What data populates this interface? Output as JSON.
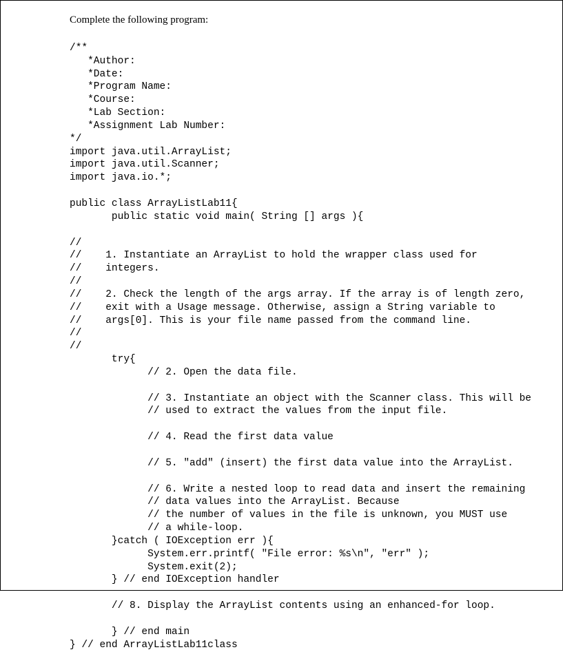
{
  "header": {
    "instruction": "Complete the following program:"
  },
  "code": {
    "line01": "/**",
    "line02": "   *Author:",
    "line03": "   *Date:",
    "line04": "   *Program Name:",
    "line05": "   *Course:",
    "line06": "   *Lab Section:",
    "line07": "   *Assignment Lab Number:",
    "line08": "*/",
    "line09": "import java.util.ArrayList;",
    "line10": "import java.util.Scanner;",
    "line11": "import java.io.*;",
    "line12": "",
    "line13": "public class ArrayListLab11{",
    "line14": "       public static void main( String [] args ){",
    "line15": "",
    "line16": "//",
    "line17": "//    1. Instantiate an ArrayList to hold the wrapper class used for",
    "line18": "//    integers.",
    "line19": "//",
    "line20": "//    2. Check the length of the args array. If the array is of length zero,",
    "line21": "//    exit with a Usage message. Otherwise, assign a String variable to",
    "line22": "//    args[0]. This is your file name passed from the command line.",
    "line23": "//",
    "line24": "//",
    "line25": "       try{",
    "line26": "             // 2. Open the data file.",
    "line27": "",
    "line28": "             // 3. Instantiate an object with the Scanner class. This will be",
    "line29": "             // used to extract the values from the input file.",
    "line30": "",
    "line31": "             // 4. Read the first data value",
    "line32": "",
    "line33": "             // 5. \"add\" (insert) the first data value into the ArrayList.",
    "line34": "",
    "line35": "             // 6. Write a nested loop to read data and insert the remaining",
    "line36": "             // data values into the ArrayList. Because",
    "line37": "             // the number of values in the file is unknown, you MUST use",
    "line38": "             // a while-loop.",
    "line39": "       }catch ( IOException err ){",
    "line40": "             System.err.printf( \"File error: %s\\n\", \"err\" );",
    "line41": "             System.exit(2);",
    "line42": "       } // end IOException handler",
    "line43": "",
    "line44": "       // 8. Display the ArrayList contents using an enhanced-for loop.",
    "line45": "",
    "line46": "       } // end main",
    "line47": "} // end ArrayListLab11class"
  }
}
